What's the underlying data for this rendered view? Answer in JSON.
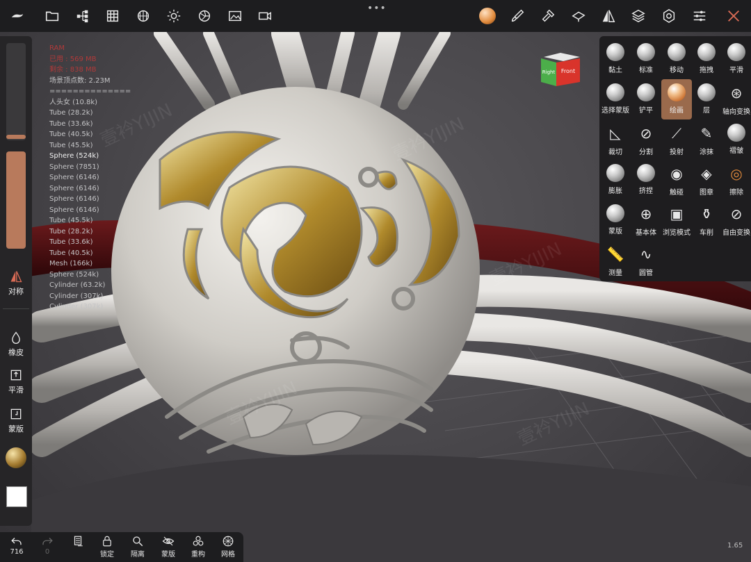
{
  "topbar": {
    "icons": [
      "menu-logo-icon",
      "folder-icon",
      "scene-tree-icon",
      "grid-icon",
      "topology-icon",
      "light-icon",
      "material-icon",
      "image-icon",
      "camera-icon"
    ],
    "right_icons": [
      "material-ball-icon",
      "brush-icon",
      "hammer-icon",
      "paint-icon",
      "symmetry-icon",
      "layers-icon",
      "settings-icon",
      "sliders-icon",
      "tools-icon"
    ],
    "more": "•••"
  },
  "left_panel": {
    "symmetry_label": "对称",
    "items": [
      {
        "label": "橡皮",
        "icon": "eraser-icon"
      },
      {
        "label": "平滑",
        "icon": "smooth-icon"
      },
      {
        "label": "蒙版",
        "icon": "mask-icon"
      }
    ],
    "colors": {
      "slider_active": "#b87a5c",
      "swatch": "#ffffff"
    }
  },
  "stats": {
    "lines": [
      {
        "text": "RAM",
        "style": "red"
      },
      {
        "text": "已用 : 569 MB",
        "style": "red"
      },
      {
        "text": "剩余 : 838 MB",
        "style": "red"
      },
      {
        "text": "场景顶点数: 2.23M",
        "style": "normal"
      },
      {
        "text": "==============",
        "style": "normal"
      },
      {
        "text": "人头女 (10.8k)",
        "style": "normal"
      },
      {
        "text": "Tube (28.2k)",
        "style": "normal"
      },
      {
        "text": "Tube (33.6k)",
        "style": "normal"
      },
      {
        "text": "Tube (40.5k)",
        "style": "normal"
      },
      {
        "text": "Tube (45.5k)",
        "style": "normal"
      },
      {
        "text": "Sphere (524k)",
        "style": "hl"
      },
      {
        "text": "Sphere (7851)",
        "style": "normal"
      },
      {
        "text": "Sphere (6146)",
        "style": "normal"
      },
      {
        "text": "Sphere (6146)",
        "style": "normal"
      },
      {
        "text": "Sphere (6146)",
        "style": "normal"
      },
      {
        "text": "Sphere (6146)",
        "style": "normal"
      },
      {
        "text": "Tube (45.5k)",
        "style": "normal"
      },
      {
        "text": "Tube (28.2k)",
        "style": "normal"
      },
      {
        "text": "Tube (33.6k)",
        "style": "normal"
      },
      {
        "text": "Tube (40.5k)",
        "style": "normal"
      },
      {
        "text": "Mesh (166k)",
        "style": "normal"
      },
      {
        "text": "Sphere (524k)",
        "style": "normal"
      },
      {
        "text": "Cylinder (63.2k)",
        "style": "normal"
      },
      {
        "text": "Cylinder (307k)",
        "style": "normal"
      },
      {
        "text": "Cylinder (307k)",
        "style": "normal"
      }
    ]
  },
  "nav_cube": {
    "right": "Right",
    "front": "Front"
  },
  "tools": [
    {
      "label": "黏土",
      "icon": "clay-icon"
    },
    {
      "label": "标准",
      "icon": "standard-icon"
    },
    {
      "label": "移动",
      "icon": "move-icon"
    },
    {
      "label": "拖拽",
      "icon": "drag-icon"
    },
    {
      "label": "平滑",
      "icon": "smooth-tool-icon"
    },
    {
      "label": "选择蒙版",
      "icon": "select-mask-icon"
    },
    {
      "label": "铲平",
      "icon": "flatten-icon"
    },
    {
      "label": "绘画",
      "icon": "paint-icon",
      "active": true
    },
    {
      "label": "层",
      "icon": "layer-icon"
    },
    {
      "label": "轴向变换",
      "icon": "gizmo-icon"
    },
    {
      "label": "裁切",
      "icon": "trim-icon"
    },
    {
      "label": "分割",
      "icon": "split-icon"
    },
    {
      "label": "投射",
      "icon": "project-icon"
    },
    {
      "label": "涂抹",
      "icon": "smudge-icon"
    },
    {
      "label": "褶皱",
      "icon": "crease-icon"
    },
    {
      "label": "膨胀",
      "icon": "inflate-icon"
    },
    {
      "label": "挤捏",
      "icon": "pinch-icon"
    },
    {
      "label": "触碰",
      "icon": "tube-icon"
    },
    {
      "label": "图章",
      "icon": "stamp-icon"
    },
    {
      "label": "擦除",
      "icon": "erase-icon"
    },
    {
      "label": "蒙版",
      "icon": "mask-tool-icon"
    },
    {
      "label": "基本体",
      "icon": "primitive-icon"
    },
    {
      "label": "浏览模式",
      "icon": "view-mode-icon"
    },
    {
      "label": "车削",
      "icon": "lathe-icon"
    },
    {
      "label": "自由变换",
      "icon": "free-transform-icon"
    },
    {
      "label": "测量",
      "icon": "measure-icon"
    },
    {
      "label": "圆管",
      "icon": "tube-curve-icon"
    }
  ],
  "bottombar": {
    "undo_count": "716",
    "redo_count": "0",
    "items": [
      {
        "label": "锁定",
        "icon": "lock-icon"
      },
      {
        "label": "隔离",
        "icon": "isolate-icon"
      },
      {
        "label": "蒙版",
        "icon": "hide-icon"
      },
      {
        "label": "重构",
        "icon": "remesh-icon"
      },
      {
        "label": "网格",
        "icon": "mesh-icon"
      }
    ]
  },
  "version": "1.65",
  "colors": {
    "accent": "#b87a5c",
    "panel": "#1e1d1f",
    "nav_front": "#d9342b",
    "nav_right": "#4cae4a"
  }
}
